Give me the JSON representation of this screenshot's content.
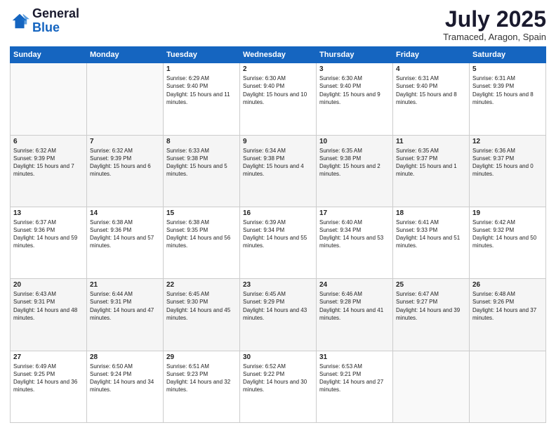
{
  "logo": {
    "general": "General",
    "blue": "Blue"
  },
  "header": {
    "month": "July 2025",
    "location": "Tramaced, Aragon, Spain"
  },
  "weekdays": [
    "Sunday",
    "Monday",
    "Tuesday",
    "Wednesday",
    "Thursday",
    "Friday",
    "Saturday"
  ],
  "weeks": [
    [
      {
        "day": "",
        "sunrise": "",
        "sunset": "",
        "daylight": ""
      },
      {
        "day": "",
        "sunrise": "",
        "sunset": "",
        "daylight": ""
      },
      {
        "day": "1",
        "sunrise": "Sunrise: 6:29 AM",
        "sunset": "Sunset: 9:40 PM",
        "daylight": "Daylight: 15 hours and 11 minutes."
      },
      {
        "day": "2",
        "sunrise": "Sunrise: 6:30 AM",
        "sunset": "Sunset: 9:40 PM",
        "daylight": "Daylight: 15 hours and 10 minutes."
      },
      {
        "day": "3",
        "sunrise": "Sunrise: 6:30 AM",
        "sunset": "Sunset: 9:40 PM",
        "daylight": "Daylight: 15 hours and 9 minutes."
      },
      {
        "day": "4",
        "sunrise": "Sunrise: 6:31 AM",
        "sunset": "Sunset: 9:40 PM",
        "daylight": "Daylight: 15 hours and 8 minutes."
      },
      {
        "day": "5",
        "sunrise": "Sunrise: 6:31 AM",
        "sunset": "Sunset: 9:39 PM",
        "daylight": "Daylight: 15 hours and 8 minutes."
      }
    ],
    [
      {
        "day": "6",
        "sunrise": "Sunrise: 6:32 AM",
        "sunset": "Sunset: 9:39 PM",
        "daylight": "Daylight: 15 hours and 7 minutes."
      },
      {
        "day": "7",
        "sunrise": "Sunrise: 6:32 AM",
        "sunset": "Sunset: 9:39 PM",
        "daylight": "Daylight: 15 hours and 6 minutes."
      },
      {
        "day": "8",
        "sunrise": "Sunrise: 6:33 AM",
        "sunset": "Sunset: 9:38 PM",
        "daylight": "Daylight: 15 hours and 5 minutes."
      },
      {
        "day": "9",
        "sunrise": "Sunrise: 6:34 AM",
        "sunset": "Sunset: 9:38 PM",
        "daylight": "Daylight: 15 hours and 4 minutes."
      },
      {
        "day": "10",
        "sunrise": "Sunrise: 6:35 AM",
        "sunset": "Sunset: 9:38 PM",
        "daylight": "Daylight: 15 hours and 2 minutes."
      },
      {
        "day": "11",
        "sunrise": "Sunrise: 6:35 AM",
        "sunset": "Sunset: 9:37 PM",
        "daylight": "Daylight: 15 hours and 1 minute."
      },
      {
        "day": "12",
        "sunrise": "Sunrise: 6:36 AM",
        "sunset": "Sunset: 9:37 PM",
        "daylight": "Daylight: 15 hours and 0 minutes."
      }
    ],
    [
      {
        "day": "13",
        "sunrise": "Sunrise: 6:37 AM",
        "sunset": "Sunset: 9:36 PM",
        "daylight": "Daylight: 14 hours and 59 minutes."
      },
      {
        "day": "14",
        "sunrise": "Sunrise: 6:38 AM",
        "sunset": "Sunset: 9:36 PM",
        "daylight": "Daylight: 14 hours and 57 minutes."
      },
      {
        "day": "15",
        "sunrise": "Sunrise: 6:38 AM",
        "sunset": "Sunset: 9:35 PM",
        "daylight": "Daylight: 14 hours and 56 minutes."
      },
      {
        "day": "16",
        "sunrise": "Sunrise: 6:39 AM",
        "sunset": "Sunset: 9:34 PM",
        "daylight": "Daylight: 14 hours and 55 minutes."
      },
      {
        "day": "17",
        "sunrise": "Sunrise: 6:40 AM",
        "sunset": "Sunset: 9:34 PM",
        "daylight": "Daylight: 14 hours and 53 minutes."
      },
      {
        "day": "18",
        "sunrise": "Sunrise: 6:41 AM",
        "sunset": "Sunset: 9:33 PM",
        "daylight": "Daylight: 14 hours and 51 minutes."
      },
      {
        "day": "19",
        "sunrise": "Sunrise: 6:42 AM",
        "sunset": "Sunset: 9:32 PM",
        "daylight": "Daylight: 14 hours and 50 minutes."
      }
    ],
    [
      {
        "day": "20",
        "sunrise": "Sunrise: 6:43 AM",
        "sunset": "Sunset: 9:31 PM",
        "daylight": "Daylight: 14 hours and 48 minutes."
      },
      {
        "day": "21",
        "sunrise": "Sunrise: 6:44 AM",
        "sunset": "Sunset: 9:31 PM",
        "daylight": "Daylight: 14 hours and 47 minutes."
      },
      {
        "day": "22",
        "sunrise": "Sunrise: 6:45 AM",
        "sunset": "Sunset: 9:30 PM",
        "daylight": "Daylight: 14 hours and 45 minutes."
      },
      {
        "day": "23",
        "sunrise": "Sunrise: 6:45 AM",
        "sunset": "Sunset: 9:29 PM",
        "daylight": "Daylight: 14 hours and 43 minutes."
      },
      {
        "day": "24",
        "sunrise": "Sunrise: 6:46 AM",
        "sunset": "Sunset: 9:28 PM",
        "daylight": "Daylight: 14 hours and 41 minutes."
      },
      {
        "day": "25",
        "sunrise": "Sunrise: 6:47 AM",
        "sunset": "Sunset: 9:27 PM",
        "daylight": "Daylight: 14 hours and 39 minutes."
      },
      {
        "day": "26",
        "sunrise": "Sunrise: 6:48 AM",
        "sunset": "Sunset: 9:26 PM",
        "daylight": "Daylight: 14 hours and 37 minutes."
      }
    ],
    [
      {
        "day": "27",
        "sunrise": "Sunrise: 6:49 AM",
        "sunset": "Sunset: 9:25 PM",
        "daylight": "Daylight: 14 hours and 36 minutes."
      },
      {
        "day": "28",
        "sunrise": "Sunrise: 6:50 AM",
        "sunset": "Sunset: 9:24 PM",
        "daylight": "Daylight: 14 hours and 34 minutes."
      },
      {
        "day": "29",
        "sunrise": "Sunrise: 6:51 AM",
        "sunset": "Sunset: 9:23 PM",
        "daylight": "Daylight: 14 hours and 32 minutes."
      },
      {
        "day": "30",
        "sunrise": "Sunrise: 6:52 AM",
        "sunset": "Sunset: 9:22 PM",
        "daylight": "Daylight: 14 hours and 30 minutes."
      },
      {
        "day": "31",
        "sunrise": "Sunrise: 6:53 AM",
        "sunset": "Sunset: 9:21 PM",
        "daylight": "Daylight: 14 hours and 27 minutes."
      },
      {
        "day": "",
        "sunrise": "",
        "sunset": "",
        "daylight": ""
      },
      {
        "day": "",
        "sunrise": "",
        "sunset": "",
        "daylight": ""
      }
    ]
  ]
}
